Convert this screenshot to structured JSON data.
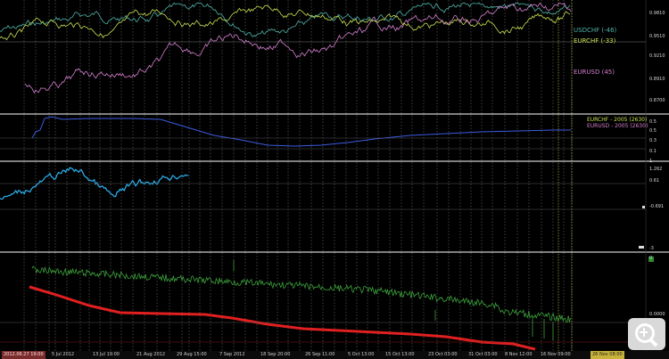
{
  "panels": [
    {
      "id": "fx-pairs",
      "series": [
        {
          "name": "USDCHF (-46)",
          "color": "#4fb3a9"
        },
        {
          "name": "EURCHF (-33)",
          "color": "#c8e052"
        },
        {
          "name": "EURUSD (45)",
          "color": "#d67fd0"
        }
      ],
      "scale_labels": [
        "0.9810",
        "0.9510",
        "0.9210",
        "0.8910",
        "0.8700"
      ]
    },
    {
      "id": "correlation",
      "series": [
        {
          "name": "EURCHF - 2005 (2630)",
          "color": "#c8e052"
        },
        {
          "name": "EURUSD - 2005 (2630)",
          "color": "#d67fd0"
        }
      ],
      "line_color": "#3d5be0",
      "scale_labels": [
        "0.5",
        "0.5",
        "0.3",
        "0.1"
      ]
    },
    {
      "id": "spread",
      "line_color": "#2aa9e6",
      "scale_labels": [
        "1",
        "1.262",
        "0.61",
        "-0.691",
        "-3"
      ]
    },
    {
      "id": "equity",
      "line_color": "#3ca03c",
      "balance_color": "#e02020",
      "scale_labels": [
        "0",
        "0.0000"
      ]
    }
  ],
  "time_axis": {
    "labels": [
      "2012.06.27 19:00",
      "5 Jul 2012",
      "13 Jul 19:00",
      "21 Aug 2012",
      "29 Aug 15:00",
      "7 Sep 2012",
      "18 Sep 20:00",
      "26 Sep 11:00",
      "5 Oct 13:00",
      "15 Oct 13:00",
      "23 Oct 03:00",
      "31 Oct 03:00",
      "8 Nov 12:00",
      "16 Nov 09:00",
      "26 Nov 08:00"
    ]
  },
  "zoom_button": {
    "icon": "zoom-in-icon"
  }
}
